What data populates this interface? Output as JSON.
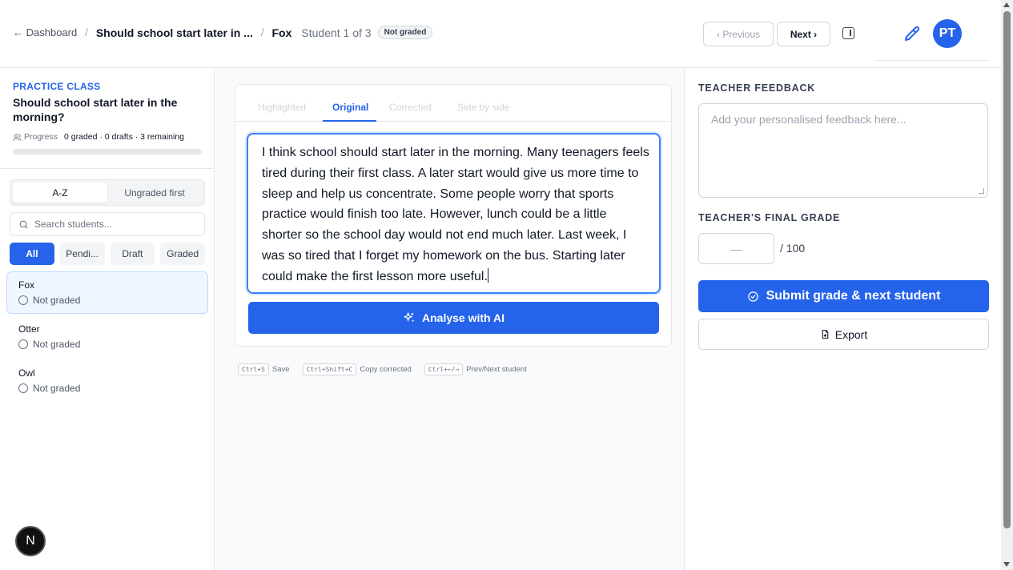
{
  "header": {
    "back_label": "← Dashboard",
    "separator": "/",
    "assignment_title": "Should school start later in ...",
    "student_name": "Fox",
    "student_count": "Student 1 of 3",
    "status_badge": "Not graded",
    "previous_label": "‹ Previous",
    "next_label": "Next ›",
    "avatar_initials": "PT",
    "icons": [
      "panel-toggle-icon",
      "pencil-icon"
    ]
  },
  "sidebar": {
    "class_label": "PRACTICE CLASS",
    "assignment_title": "Should school start later in the morning?",
    "progress_label": "Progress",
    "progress_value": "0 graded · 0 drafts · 3 remaining",
    "progress_fraction": 0,
    "sort_options": [
      "A-Z",
      "Ungraded first"
    ],
    "sort_selected": "A-Z",
    "search_placeholder": "Search students...",
    "filters": [
      "All",
      "Pendi...",
      "Draft",
      "Graded"
    ],
    "filter_selected": "All",
    "students": [
      {
        "name": "Fox",
        "status": "Not graded"
      },
      {
        "name": "Otter",
        "status": "Not graded"
      },
      {
        "name": "Owl",
        "status": "Not graded"
      }
    ],
    "bottom_badge": "N"
  },
  "main": {
    "tabs": [
      "Highlighted",
      "Original",
      "Corrected",
      "Side by side"
    ],
    "active_tab": "Original",
    "essay_text": "I think school should start later in the morning. Many teenagers feels tired during their first class. A later start would give us more time to sleep and help us concentrate. Some people worry that sports practice would finish too late. However, lunch could be a little shorter so the school day would not end much later. Last week, I was so tired that I forget my homework on the bus. Starting later could make the first lesson more useful.",
    "analyse_label": "Analyse with AI",
    "shortcuts": [
      {
        "key": "Ctrl+S",
        "label": "Save"
      },
      {
        "key": "Ctrl+Shift+C",
        "label": "Copy corrected"
      },
      {
        "key": "Ctrl+←/→",
        "label": "Prev/Next student"
      }
    ]
  },
  "right": {
    "feedback_title": "TEACHER FEEDBACK",
    "feedback_placeholder": "Add your personalised feedback here...",
    "grade_title": "TEACHER'S FINAL GRADE",
    "grade_value": "—",
    "grade_max": "/ 100",
    "submit_label": "Submit grade & next student",
    "export_label": "Export"
  },
  "colors": {
    "accent": "#2563eb",
    "accent_light": "#eff6ff",
    "border": "#e5e7eb",
    "text": "#111827",
    "muted": "#6b7280"
  }
}
